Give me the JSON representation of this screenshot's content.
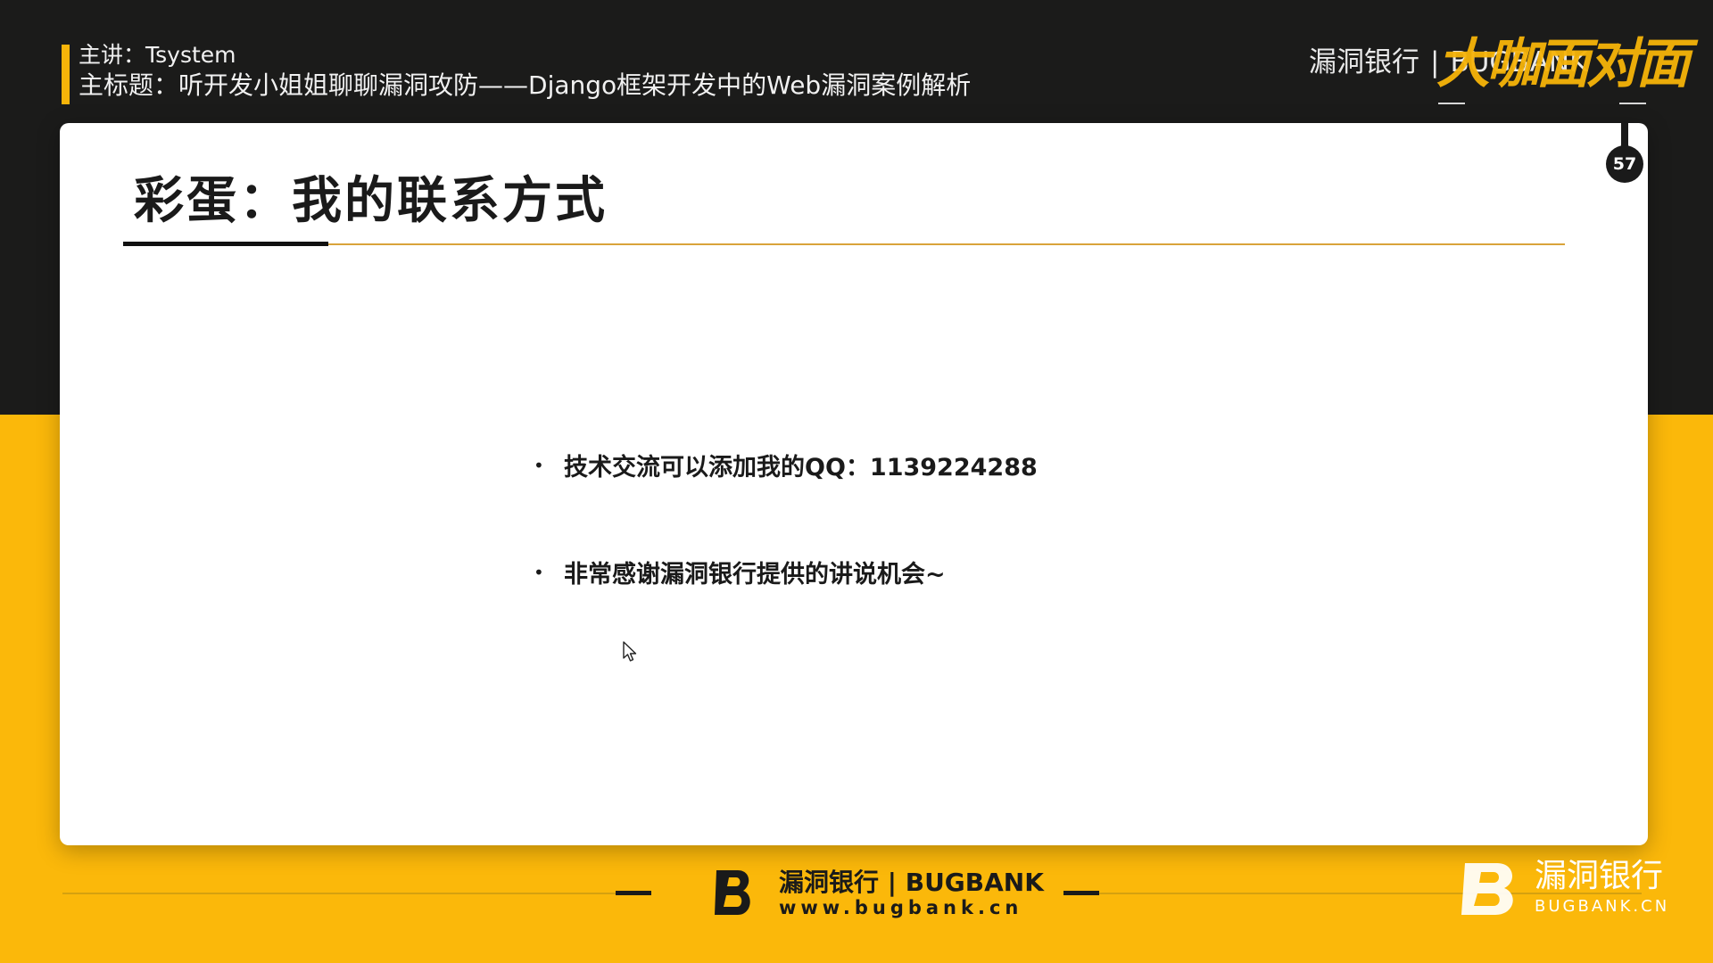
{
  "header": {
    "speaker": "主讲：Tsystem",
    "topic": "主标题：听开发小姐姐聊聊漏洞攻防——Django框架开发中的Web漏洞案例解析"
  },
  "brand_top": {
    "name": "漏洞银行",
    "separator": "|",
    "name_en": "BUGBANK",
    "live_badge": "大咖面对面"
  },
  "slide": {
    "title": "彩蛋：我的联系方式",
    "page_number": "57",
    "bullets": [
      {
        "dot": "•",
        "text": "技术交流可以添加我的QQ：1139224288"
      },
      {
        "dot": "•",
        "text": "非常感谢漏洞银行提供的讲说机会~"
      }
    ]
  },
  "footer": {
    "brand": "漏洞银行 | BUGBANK",
    "url": "www.bugbank.cn"
  },
  "corner_logo": {
    "brand": "漏洞银行",
    "sub": "BUGBANK.CN"
  },
  "colors": {
    "dark": "#1b1b1a",
    "yellow": "#fbb80a",
    "accent": "#f7b409",
    "rule": "#d9a33a"
  }
}
